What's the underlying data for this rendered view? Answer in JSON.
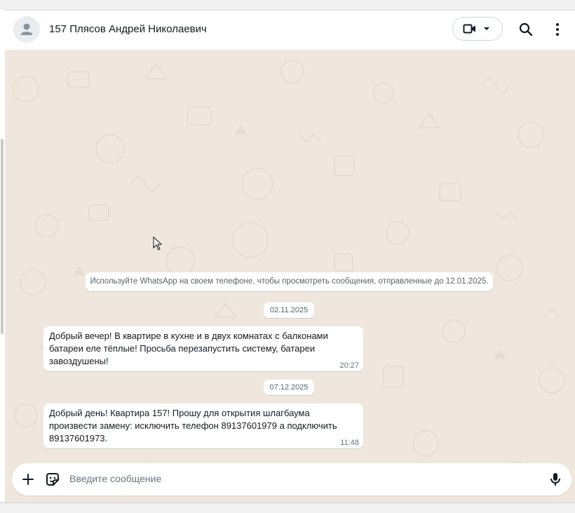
{
  "header": {
    "contact_name": "157 Плясов Андрей Николаевич",
    "icons": [
      "person-avatar-icon",
      "video-camera-icon",
      "chevron-down-icon",
      "search-icon",
      "more-vertical-icon"
    ]
  },
  "chat": {
    "background_color": "#efe7dd",
    "system_note": "Используйте WhatsApp на своем телефоне, чтобы просмотреть сообщения, отправленные до 12.01.2025.",
    "messages": [
      {
        "date": "02.11.2025",
        "lines": [
          "Добрый вечер!  В квартире в кухне и в двух комнатах с балконами",
          "батареи еле тёплые! Просьба перезапустить систему, батареи",
          "завоздушены!"
        ],
        "time": "20:27"
      },
      {
        "date": "07.12.2025",
        "lines": [
          "Добрый день!  Квартира 157! Прошу для открытия шлагбаума",
          "произвести замену: исключить телефон 89137601979 а подключить",
          "89137601973."
        ],
        "time": "11:48"
      }
    ]
  },
  "composer": {
    "placeholder": "Введите сообщение",
    "icons": [
      "plus-icon",
      "sticker-icon",
      "microphone-icon"
    ]
  }
}
